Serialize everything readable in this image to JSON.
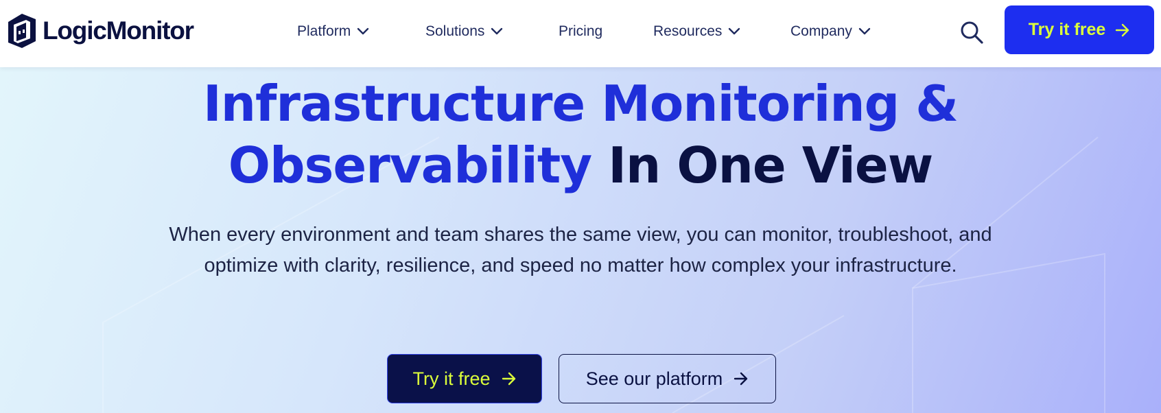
{
  "header": {
    "logo_text": "LogicMonitor",
    "nav": [
      {
        "label": "Platform",
        "has_dropdown": true
      },
      {
        "label": "Solutions",
        "has_dropdown": true
      },
      {
        "label": "Pricing",
        "has_dropdown": false
      },
      {
        "label": "Resources",
        "has_dropdown": true
      },
      {
        "label": "Company",
        "has_dropdown": true
      }
    ],
    "search_icon": "search-icon",
    "cta_label": "Try it free",
    "cta_icon": "arrow-right-icon"
  },
  "hero": {
    "title_line1": "Infrastructure Monitoring &",
    "title_line2_accent": "Observability",
    "title_line2_dark": "In One View",
    "subtitle": "When every environment and team shares the same view, you can monitor, troubleshoot, and optimize with clarity, resilience, and speed no matter how complex your infrastructure.",
    "primary_cta": "Try it free",
    "secondary_cta": "See our platform"
  },
  "colors": {
    "brand_blue": "#1d2ef0",
    "accent_text": "#1f2fd9",
    "dark_navy": "#0a1142",
    "cta_text": "#dcff3a"
  }
}
